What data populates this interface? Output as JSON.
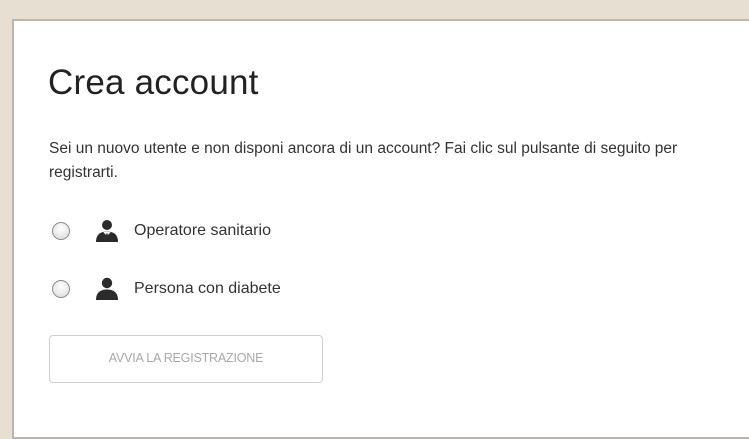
{
  "create_account": {
    "title": "Crea account",
    "description": "Sei un nuovo utente e non disponi ancora di un account? Fai clic sul pulsante di seguito per registrarti.",
    "options": [
      {
        "label": "Operatore sanitario",
        "icon": "healthcare-worker-icon",
        "selected": false
      },
      {
        "label": "Persona con diabete",
        "icon": "person-icon",
        "selected": false
      }
    ],
    "start_button_label": "AVVIA LA REGISTRAZIONE",
    "colors": {
      "background": "#e8dfd3",
      "card": "#ffffff",
      "text": "#222222",
      "disabled_text": "#a8a8a8"
    }
  }
}
